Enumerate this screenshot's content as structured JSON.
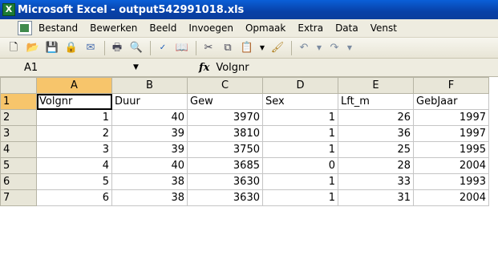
{
  "window": {
    "title": "Microsoft Excel - output542991018.xls"
  },
  "menu": [
    {
      "label": "Bestand"
    },
    {
      "label": "Bewerken"
    },
    {
      "label": "Beeld"
    },
    {
      "label": "Invoegen"
    },
    {
      "label": "Opmaak"
    },
    {
      "label": "Extra"
    },
    {
      "label": "Data"
    },
    {
      "label": "Venst"
    }
  ],
  "formula_bar": {
    "cell_ref": "A1",
    "fx_label": "fx",
    "value": "Volgnr"
  },
  "columns": [
    "A",
    "B",
    "C",
    "D",
    "E",
    "F"
  ],
  "rows": [
    {
      "num": "1",
      "cells": [
        "Volgnr",
        "Duur",
        "Gew",
        "Sex",
        "Lft_m",
        "GebJaar"
      ]
    },
    {
      "num": "2",
      "cells": [
        "1",
        "40",
        "3970",
        "1",
        "26",
        "1997"
      ]
    },
    {
      "num": "3",
      "cells": [
        "2",
        "39",
        "3810",
        "1",
        "36",
        "1997"
      ]
    },
    {
      "num": "4",
      "cells": [
        "3",
        "39",
        "3750",
        "1",
        "25",
        "1995"
      ]
    },
    {
      "num": "5",
      "cells": [
        "4",
        "40",
        "3685",
        "0",
        "28",
        "2004"
      ]
    },
    {
      "num": "6",
      "cells": [
        "5",
        "38",
        "3630",
        "1",
        "33",
        "1993"
      ]
    },
    {
      "num": "7",
      "cells": [
        "6",
        "38",
        "3630",
        "1",
        "31",
        "2004"
      ]
    }
  ]
}
